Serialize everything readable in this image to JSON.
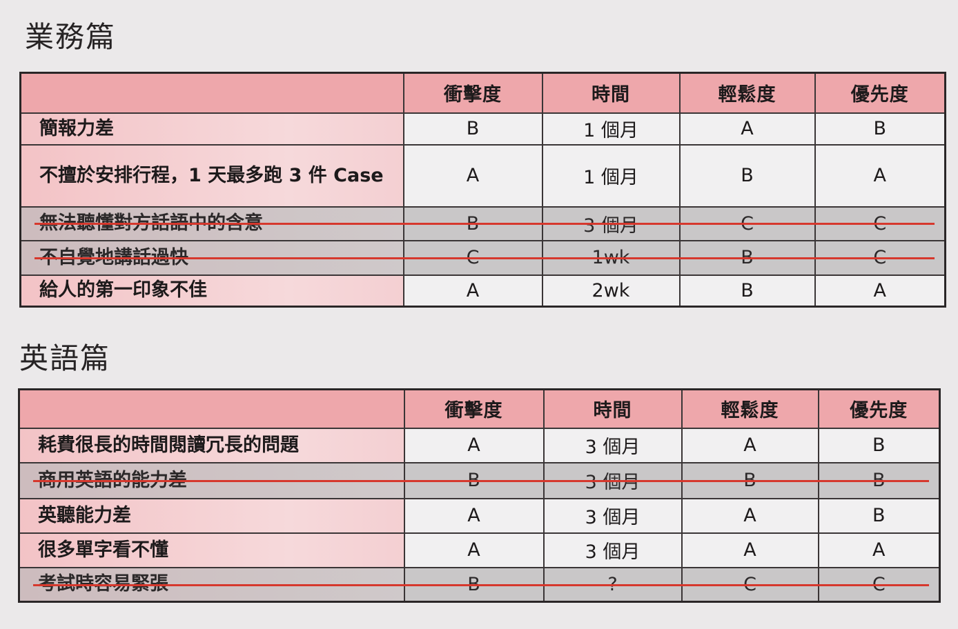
{
  "sections": [
    {
      "title": "業務篇",
      "headers": [
        "",
        "衝擊度",
        "時間",
        "輕鬆度",
        "優先度"
      ],
      "rows": [
        {
          "item": "簡報力差",
          "impact": "B",
          "time": "1 個月",
          "ease": "A",
          "priority": "B",
          "struck": false
        },
        {
          "item": "不擅於安排行程，1 天最多跑 3 件 Case",
          "impact": "A",
          "time": "1 個月",
          "ease": "B",
          "priority": "A",
          "struck": false
        },
        {
          "item": "無法聽懂對方話語中的含意",
          "impact": "B",
          "time": "3 個月",
          "ease": "C",
          "priority": "C",
          "struck": true
        },
        {
          "item": "不自覺地講話過快",
          "impact": "C",
          "time": "1wk",
          "ease": "B",
          "priority": "C",
          "struck": true
        },
        {
          "item": "給人的第一印象不佳",
          "impact": "A",
          "time": "2wk",
          "ease": "B",
          "priority": "A",
          "struck": false
        }
      ]
    },
    {
      "title": "英語篇",
      "headers": [
        "",
        "衝擊度",
        "時間",
        "輕鬆度",
        "優先度"
      ],
      "rows": [
        {
          "item": "耗費很長的時間閱讀冗長的問題",
          "impact": "A",
          "time": "3 個月",
          "ease": "A",
          "priority": "B",
          "struck": false
        },
        {
          "item": "商用英語的能力差",
          "impact": "B",
          "time": "3 個月",
          "ease": "B",
          "priority": "B",
          "struck": true
        },
        {
          "item": "英聽能力差",
          "impact": "A",
          "time": "3 個月",
          "ease": "A",
          "priority": "B",
          "struck": false
        },
        {
          "item": "很多單字看不懂",
          "impact": "A",
          "time": "3 個月",
          "ease": "A",
          "priority": "A",
          "struck": false
        },
        {
          "item": "考試時容易緊張",
          "impact": "B",
          "time": "?",
          "ease": "C",
          "priority": "C",
          "struck": true
        }
      ]
    }
  ],
  "colors": {
    "header_fill": "#eea7ab",
    "item_fill": "#f3c3c6",
    "struck_row_fill": "#c9c7c8",
    "strike_line": "#d6382d"
  }
}
